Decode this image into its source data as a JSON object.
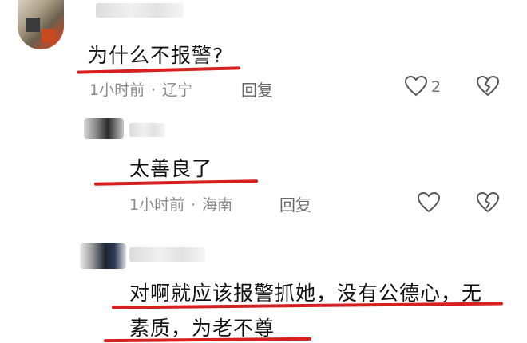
{
  "comments": [
    {
      "text": "为什么不报警?",
      "time": "1小时前",
      "location": "辽宁",
      "reply_label": "回复",
      "likes": "2"
    },
    {
      "text": "太善良了",
      "time": "1小时前",
      "location": "海南",
      "reply_label": "回复"
    },
    {
      "text_line1": "对啊就应该报警抓她，没有公德心，无",
      "text_line2": "素质，为老不尊"
    }
  ],
  "colors": {
    "annotation_red": "#d61f1f",
    "meta_gray": "#8a8a8a",
    "icon_gray": "#555555"
  },
  "icons": [
    "heart-outline-icon",
    "broken-heart-icon"
  ]
}
